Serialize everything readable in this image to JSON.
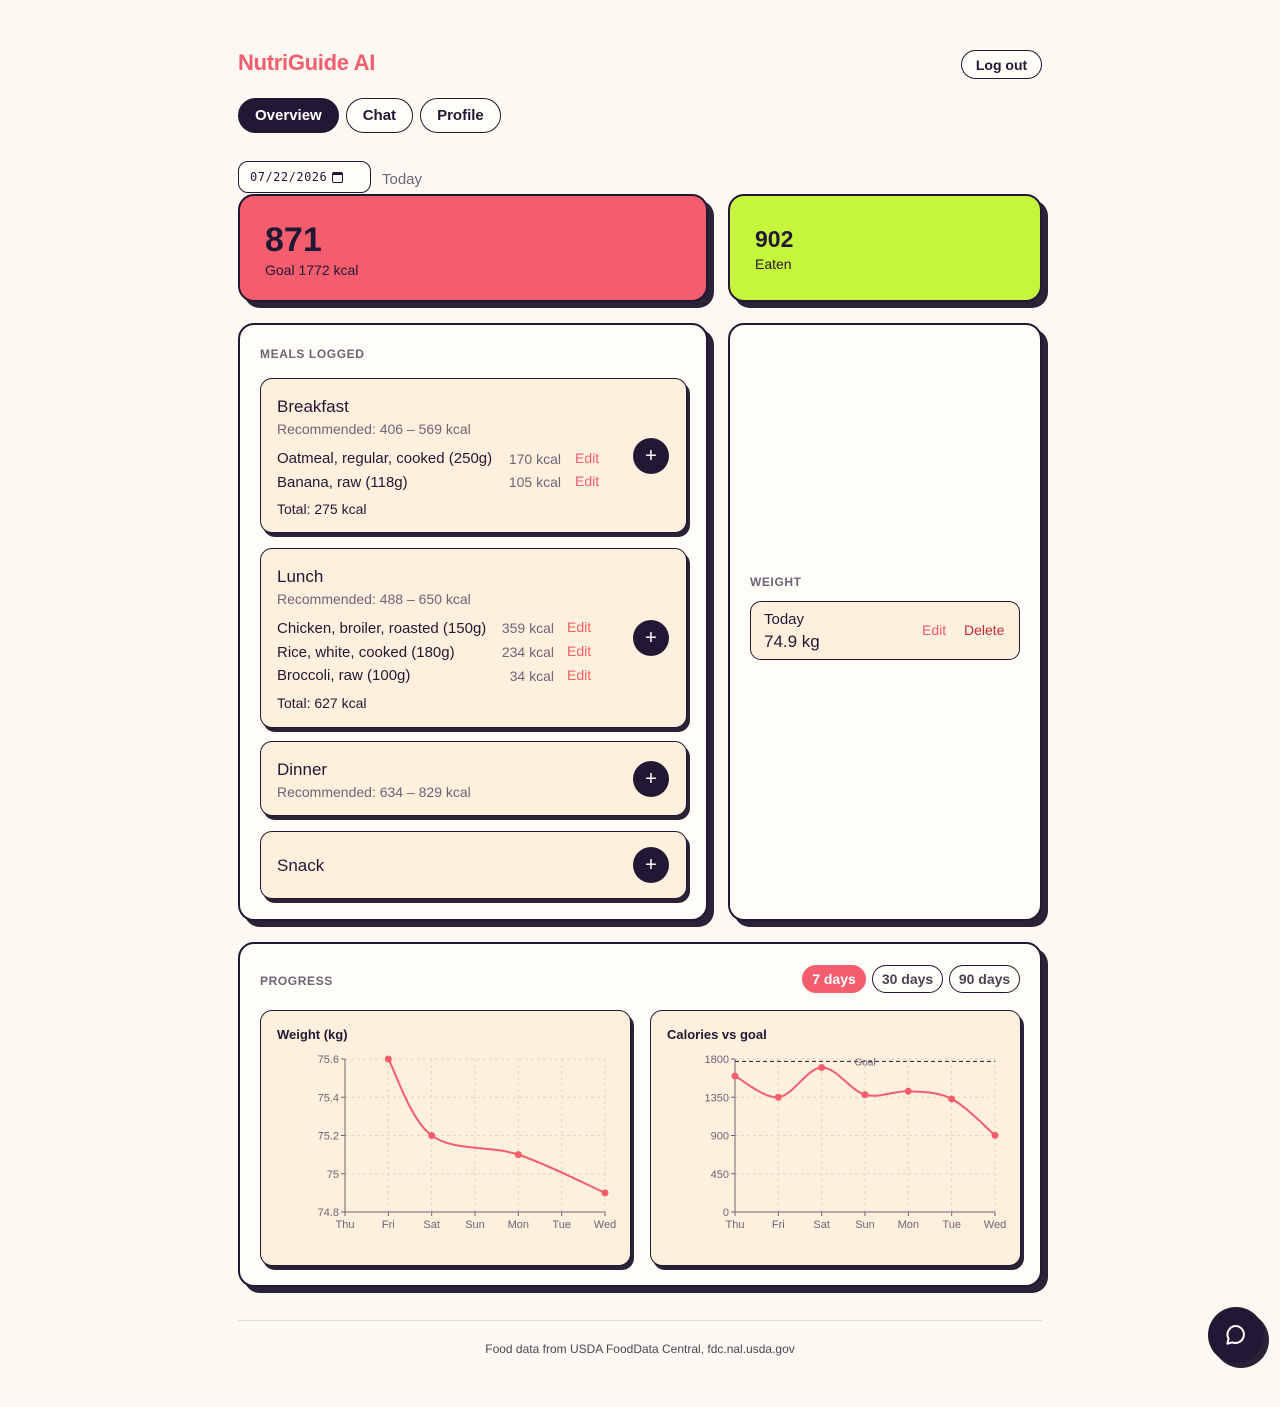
{
  "app": {
    "brand": "NutriGuide AI",
    "logout_label": "Log out"
  },
  "tabs": [
    {
      "label": "Overview",
      "active": true
    },
    {
      "label": "Chat"
    },
    {
      "label": "Profile"
    }
  ],
  "date": {
    "value": "07/22/2026",
    "label": "Today"
  },
  "stats": {
    "remaining": {
      "value": "871",
      "label": "Goal 1772 kcal"
    },
    "eaten": {
      "value": "902",
      "label": "Eaten"
    }
  },
  "meals": {
    "title": "MEALS LOGGED",
    "edit_label": "Edit",
    "breakfast": {
      "name": "Breakfast",
      "recommended": "Recommended: 406 – 569 kcal",
      "items": [
        {
          "name": "Oatmeal, regular, cooked (250g)",
          "kcal": "170 kcal"
        },
        {
          "name": "Banana, raw (118g)",
          "kcal": "105 kcal"
        }
      ],
      "total": "Total: 275 kcal"
    },
    "lunch": {
      "name": "Lunch",
      "recommended": "Recommended: 488 – 650 kcal",
      "items": [
        {
          "name": "Chicken, broiler, roasted (150g)",
          "kcal": "359 kcal"
        },
        {
          "name": "Rice, white, cooked (180g)",
          "kcal": "234 kcal"
        },
        {
          "name": "Broccoli, raw (100g)",
          "kcal": "34 kcal"
        }
      ],
      "total": "Total: 627 kcal"
    },
    "dinner": {
      "name": "Dinner",
      "recommended": "Recommended: 634 – 829 kcal"
    },
    "snack": {
      "name": "Snack"
    },
    "add_icon": "+"
  },
  "weight": {
    "title": "WEIGHT",
    "entry": {
      "day": "Today",
      "value": "74.9 kg",
      "edit_label": "Edit",
      "delete_label": "Delete"
    }
  },
  "progress": {
    "title": "PROGRESS",
    "ranges": [
      {
        "label": "7 days",
        "active": true
      },
      {
        "label": "30 days"
      },
      {
        "label": "90 days"
      }
    ]
  },
  "chart_data": [
    {
      "type": "line",
      "title": "Weight (kg)",
      "x": [
        "Thu",
        "Fri",
        "Sat",
        "Sun",
        "Mon",
        "Tue",
        "Wed"
      ],
      "series": [
        {
          "values": [
            null,
            75.6,
            75.2,
            null,
            75.1,
            null,
            74.9
          ]
        }
      ],
      "yticks": [
        74.8,
        75,
        75.2,
        75.4,
        75.6
      ],
      "ylim": [
        74.8,
        75.6
      ],
      "grid": true,
      "color": "#f45d6e"
    },
    {
      "type": "line",
      "title": "Calories vs goal",
      "x": [
        "Thu",
        "Fri",
        "Sat",
        "Sun",
        "Mon",
        "Tue",
        "Wed"
      ],
      "series": [
        {
          "values": [
            1600,
            1350,
            1700,
            1380,
            1420,
            1330,
            902
          ]
        }
      ],
      "yticks": [
        0,
        450,
        900,
        1350,
        1800
      ],
      "ylim": [
        0,
        1800
      ],
      "goal": {
        "value": 1772,
        "label": "Goal"
      },
      "grid": true,
      "color": "#f45d6e"
    }
  ],
  "footer": {
    "text": "Food data from USDA FoodData Central, fdc.nal.usda.gov"
  },
  "chat_fab": {
    "icon": "chat-bubble-icon"
  }
}
